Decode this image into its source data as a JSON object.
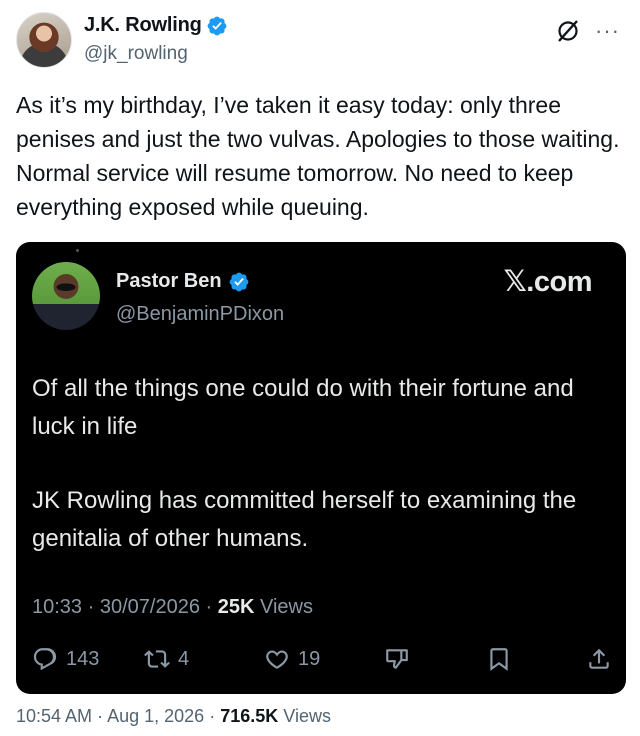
{
  "author": {
    "display_name": "J.K. Rowling",
    "handle": "@jk_rowling",
    "verified": true,
    "avatar": "author-avatar-photo"
  },
  "tweet": {
    "text": "As it’s my birthday, I’ve taken it easy today: only three penises and just the two vulvas. Apologies to those waiting. Normal service will resume tomorrow. No need to keep everything exposed while queuing."
  },
  "top_icons": {
    "grok": "grok-icon",
    "more": "···"
  },
  "embed": {
    "author": {
      "display_name": "Pastor Ben",
      "handle": "@BenjaminPDixon",
      "verified": true
    },
    "brand": "𝕏.com",
    "paragraphs": [
      "Of all the things one could do with their fortune and luck in life",
      "JK Rowling has committed herself to examining the genitalia of other humans."
    ],
    "time": "10:33",
    "date": "30/07/2026",
    "views_count": "25K",
    "views_label": "Views",
    "actions": {
      "replies": "143",
      "reposts": "4",
      "likes": "19"
    }
  },
  "footer": {
    "time": "10:54 AM",
    "date": "Aug 1, 2026",
    "views_count": "716.5K",
    "views_label": "Views"
  },
  "colors": {
    "verified_blue": "#1d9bf0",
    "text": "#0f1419",
    "secondary": "#536471",
    "embed_bg": "#000000"
  }
}
